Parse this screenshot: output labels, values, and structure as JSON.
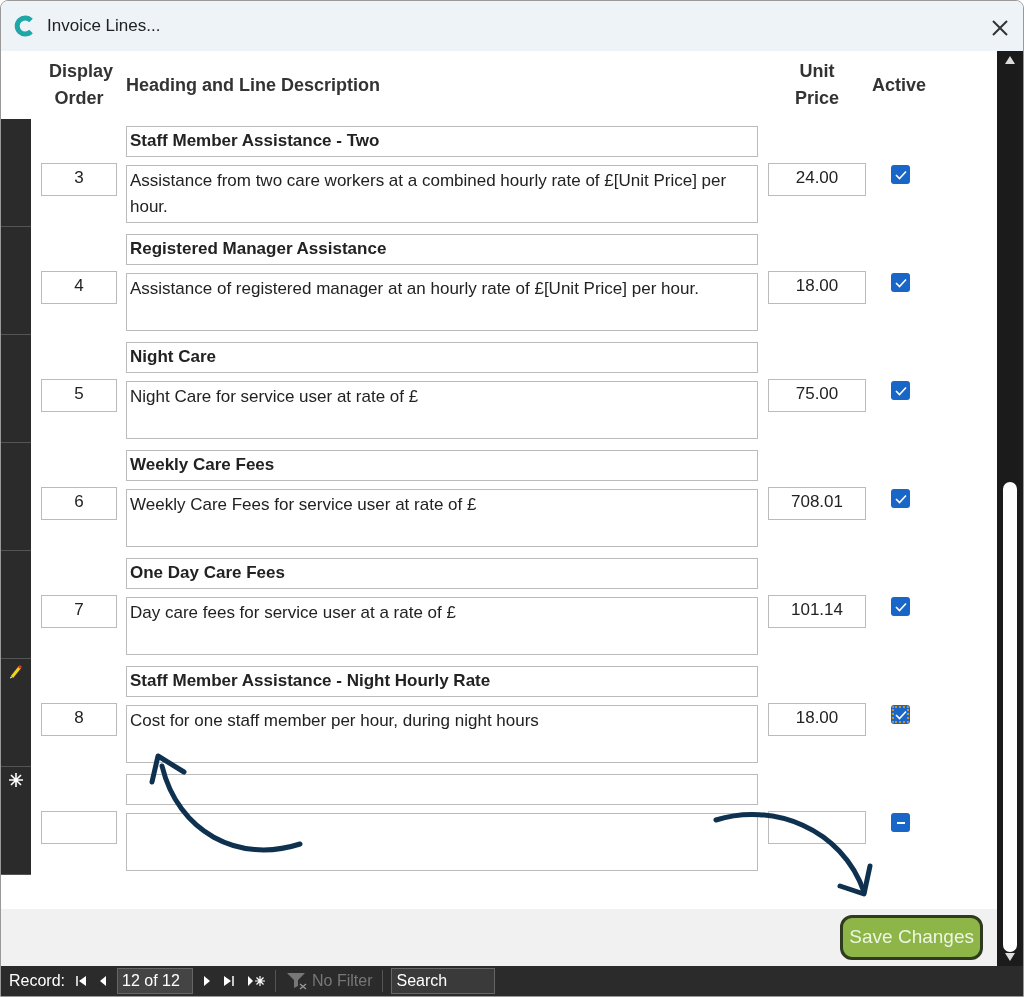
{
  "window": {
    "title": "Invoice Lines..."
  },
  "columns": [
    {
      "label": "Display Order"
    },
    {
      "label": "Heading and Line Description"
    },
    {
      "label": "Unit Price"
    },
    {
      "label": "Active"
    }
  ],
  "rows": [
    {
      "kind": "record",
      "editing": false,
      "order": "3",
      "heading": "Staff Member Assistance - Two",
      "description": "Assistance from two care workers at a combined hourly rate of £[Unit Price] per hour.",
      "unit_price": "24.00",
      "checked": true
    },
    {
      "kind": "record",
      "editing": false,
      "order": "4",
      "heading": "Registered Manager Assistance",
      "description": "Assistance of registered manager at an hourly rate of £[Unit Price] per hour.",
      "unit_price": "18.00",
      "checked": true
    },
    {
      "kind": "record",
      "editing": false,
      "order": "5",
      "heading": "Night Care",
      "description": "Night Care for service user at rate of £",
      "unit_price": "75.00",
      "checked": true
    },
    {
      "kind": "record",
      "editing": false,
      "order": "6",
      "heading": "Weekly Care Fees",
      "description": "Weekly Care Fees for service user at rate of £",
      "unit_price": "708.01",
      "checked": true
    },
    {
      "kind": "record",
      "editing": false,
      "order": "7",
      "heading": "One Day Care Fees",
      "description": "Day care fees for service user at a rate of £",
      "unit_price": "101.14",
      "checked": true
    },
    {
      "kind": "record",
      "editing": true,
      "order": "8",
      "heading": "Staff Member Assistance - Night Hourly Rate",
      "description": "Cost for one staff member per hour, during night hours",
      "unit_price": "18.00",
      "checked": true
    },
    {
      "kind": "new",
      "editing": false,
      "indeterminate": true
    }
  ],
  "save_button": {
    "label": "Save Changes"
  },
  "navigation": {
    "label": "Record:",
    "position": "12 of 12",
    "filter": {
      "label": "No Filter",
      "disabled": true
    },
    "search": {
      "placeholder": "Search"
    }
  }
}
